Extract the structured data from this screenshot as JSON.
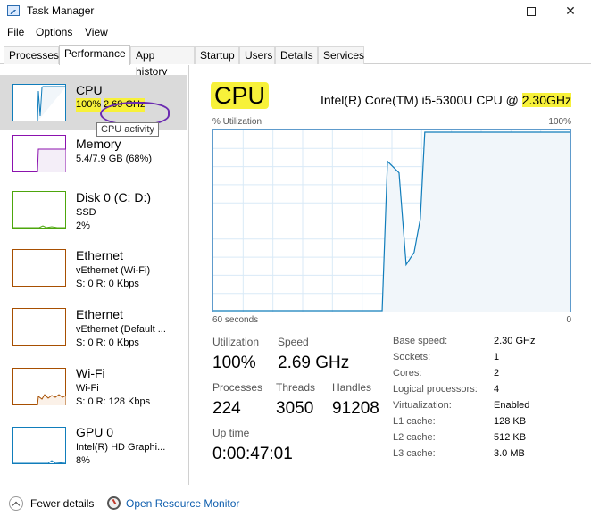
{
  "window": {
    "title": "Task Manager",
    "minimize": "—",
    "close": "✕"
  },
  "menu": [
    "File",
    "Options",
    "View"
  ],
  "tabs": [
    "Processes",
    "Performance",
    "App history",
    "Startup",
    "Users",
    "Details",
    "Services"
  ],
  "sidebar": {
    "items": [
      {
        "title": "CPU",
        "line1_a": "100%",
        "line1_b": "2.69 GHz",
        "color": "#117dbb"
      },
      {
        "title": "Memory",
        "line1": "5.4/7.9 GB (68%)",
        "color": "#8b12ae"
      },
      {
        "title": "Disk 0 (C: D:)",
        "line1": "SSD",
        "line2": "2%",
        "color": "#4da60c"
      },
      {
        "title": "Ethernet",
        "line1": "vEthernet (Wi-Fi)",
        "line2": "S: 0 R: 0 Kbps",
        "color": "#a74f01"
      },
      {
        "title": "Ethernet",
        "line1": "vEthernet (Default ...",
        "line2": "S: 0 R: 0 Kbps",
        "color": "#a74f01"
      },
      {
        "title": "Wi-Fi",
        "line1": "Wi-Fi",
        "line2": "S: 0 R: 128 Kbps",
        "color": "#a74f01"
      },
      {
        "title": "GPU 0",
        "line1": "Intel(R) HD Graphi...",
        "line2": "8%",
        "color": "#117dbb"
      }
    ],
    "tooltip": "CPU activity"
  },
  "main": {
    "heading": "CPU",
    "model_prefix": "Intel(R) Core(TM) i5-5300U CPU @ ",
    "model_speed": "2.30GHz",
    "util_label": "% Utilization",
    "util_max": "100%",
    "axis_left": "60 seconds",
    "axis_right": "0",
    "stats": {
      "utilization_label": "Utilization",
      "utilization": "100%",
      "speed_label": "Speed",
      "speed": "2.69 GHz",
      "processes_label": "Processes",
      "processes": "224",
      "threads_label": "Threads",
      "threads": "3050",
      "handles_label": "Handles",
      "handles": "91208",
      "uptime_label": "Up time",
      "uptime": "0:00:47:01"
    },
    "specs": [
      {
        "label": "Base speed:",
        "value": "2.30 GHz"
      },
      {
        "label": "Sockets:",
        "value": "1"
      },
      {
        "label": "Cores:",
        "value": "2"
      },
      {
        "label": "Logical processors:",
        "value": "4"
      },
      {
        "label": "Virtualization:",
        "value": "Enabled"
      },
      {
        "label": "L1 cache:",
        "value": "128 KB"
      },
      {
        "label": "L2 cache:",
        "value": "512 KB"
      },
      {
        "label": "L3 cache:",
        "value": "3.0 MB"
      }
    ]
  },
  "footer": {
    "fewer": "Fewer details",
    "resource_monitor": "Open Resource Monitor"
  },
  "colors": {
    "graph_line": "#117dbb",
    "graph_fill": "#f1f6fa",
    "highlight": "#f7f13a"
  }
}
